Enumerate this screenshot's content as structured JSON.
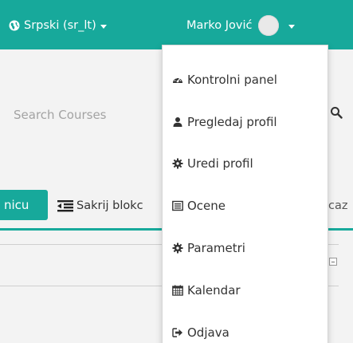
{
  "navbar": {
    "language_label": "Srpski (sr_lt)",
    "user_name": "Marko Jović",
    "background_color": "#17a99b"
  },
  "search": {
    "placeholder": "Search Courses"
  },
  "toolbar": {
    "partial_button_label": "nicu",
    "hide_blocks_label": "Sakrij blokc",
    "partial_right_label": "caz"
  },
  "user_menu": {
    "items": [
      {
        "label": "Kontrolni panel",
        "icon": "dashboard-icon"
      },
      {
        "label": "Pregledaj profil",
        "icon": "user-icon"
      },
      {
        "label": "Uredi profil",
        "icon": "cog-icon"
      },
      {
        "label": "Ocene",
        "icon": "list-icon"
      },
      {
        "label": "Parametri",
        "icon": "cog-icon"
      },
      {
        "label": "Kalendar",
        "icon": "calendar-icon"
      },
      {
        "label": "Odjava",
        "icon": "sign-out-icon"
      }
    ]
  }
}
